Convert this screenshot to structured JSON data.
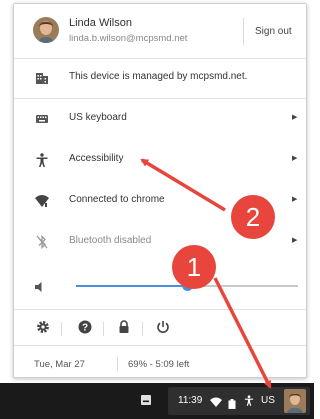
{
  "user": {
    "name": "Linda Wilson",
    "email": "linda.b.wilson@mcpsmd.net",
    "sign_out": "Sign out"
  },
  "managed_notice": "This device is managed by mcpsmd.net.",
  "menu": {
    "keyboard": "US keyboard",
    "accessibility": "Accessibility",
    "network": "Connected to chrome",
    "bluetooth": "Bluetooth disabled"
  },
  "volume": {
    "level": 0.5
  },
  "status": {
    "date": "Tue, Mar 27",
    "battery": "69% - 5:09 left"
  },
  "shelf": {
    "time": "11:39",
    "lang": "US"
  },
  "annotations": [
    {
      "number": "1",
      "color": "#e8453c"
    },
    {
      "number": "2",
      "color": "#e8453c"
    }
  ],
  "colors": {
    "accent": "#4a90e2",
    "annotation": "#e8453c",
    "shelf": "#1a1a1a"
  }
}
